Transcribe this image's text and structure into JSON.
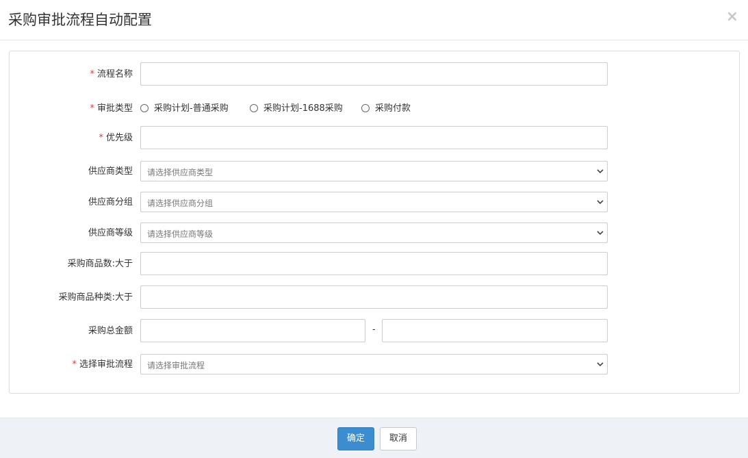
{
  "dialog": {
    "title": "采购审批流程自动配置",
    "close_glyph": "×"
  },
  "form": {
    "flow_name": {
      "label": "流程名称",
      "required": "*",
      "value": ""
    },
    "approval_type": {
      "label": "审批类型",
      "required": "*",
      "options": [
        "采购计划-普通采购",
        "采购计划-1688采购",
        "采购付款"
      ]
    },
    "priority": {
      "label": "优先级",
      "required": "*",
      "value": ""
    },
    "supplier_type": {
      "label": "供应商类型",
      "placeholder": "请选择供应商类型"
    },
    "supplier_group": {
      "label": "供应商分组",
      "placeholder": "请选择供应商分组"
    },
    "supplier_level": {
      "label": "供应商等级",
      "placeholder": "请选择供应商等级"
    },
    "goods_count": {
      "label": "采购商品数:大于",
      "value": ""
    },
    "goods_kinds": {
      "label": "采购商品种类:大于",
      "value": ""
    },
    "total_amount": {
      "label": "采购总金额",
      "separator": "-",
      "min": "",
      "max": ""
    },
    "approval_flow": {
      "label": "选择审批流程",
      "required": "*",
      "placeholder": "请选择审批流程"
    }
  },
  "footer": {
    "ok_label": "确定",
    "cancel_label": "取消"
  },
  "colors": {
    "primary": "#3c8dcf",
    "required": "#e4393c",
    "footer_bg": "#eef1f6"
  }
}
